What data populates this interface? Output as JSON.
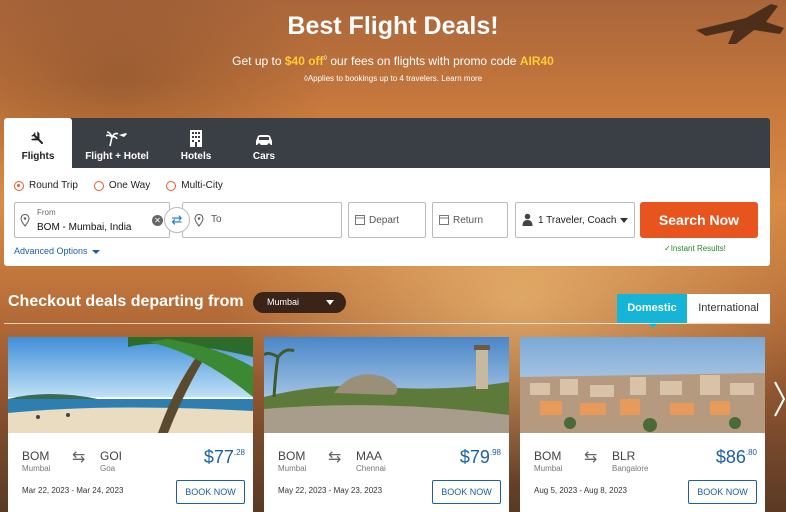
{
  "hero": {
    "title": "Best Flight Deals!",
    "promo_prefix": "Get up to ",
    "promo_amount": "$40 off",
    "promo_mark": "◊",
    "promo_mid": " our fees on flights with promo code ",
    "promo_code": "AIR40",
    "promo_sub": "◊Applies to bookings up to 4 travelers. Learn more"
  },
  "tabs": [
    {
      "label": "Flights",
      "icon": "plane-icon",
      "active": true
    },
    {
      "label": "Flight + Hotel",
      "icon": "palm-icon",
      "active": false
    },
    {
      "label": "Hotels",
      "icon": "hotel-icon",
      "active": false
    },
    {
      "label": "Cars",
      "icon": "car-icon",
      "active": false
    }
  ],
  "trip_types": [
    {
      "label": "Round Trip",
      "selected": true
    },
    {
      "label": "One Way",
      "selected": false
    },
    {
      "label": "Multi-City",
      "selected": false
    }
  ],
  "search": {
    "from_label": "From",
    "from_value": "BOM - Mumbai, India",
    "to_placeholder": "To",
    "depart_placeholder": "Depart",
    "return_placeholder": "Return",
    "travelers": "1 Traveler, Coach",
    "button": "Search Now",
    "instant": "✓Instant Results!",
    "advanced": "Advanced Options"
  },
  "deals": {
    "title": "Checkout deals departing from",
    "city": "Mumbai",
    "tab_domestic": "Domestic",
    "tab_international": "International",
    "cards": [
      {
        "from_code": "BOM",
        "from_city": "Mumbai",
        "to_code": "GOI",
        "to_city": "Goa",
        "price": "$77",
        "cents": ".28",
        "dates": "Mar 22, 2023 - Mar 24, 2023",
        "button": "BOOK NOW"
      },
      {
        "from_code": "BOM",
        "from_city": "Mumbai",
        "to_code": "MAA",
        "to_city": "Chennai",
        "price": "$79",
        "cents": ".98",
        "dates": "May 22, 2023 - May 23, 2023",
        "button": "BOOK NOW"
      },
      {
        "from_code": "BOM",
        "from_city": "Mumbai",
        "to_code": "BLR",
        "to_city": "Bangalore",
        "price": "$86",
        "cents": ".80",
        "dates": "Aug 5, 2023 - Aug 8, 2023",
        "button": "BOOK NOW"
      }
    ]
  },
  "colors": {
    "accent": "#e8541e",
    "link": "#1a5fa8",
    "domestic_tab": "#14b5d6",
    "promo": "#ffcc33"
  }
}
